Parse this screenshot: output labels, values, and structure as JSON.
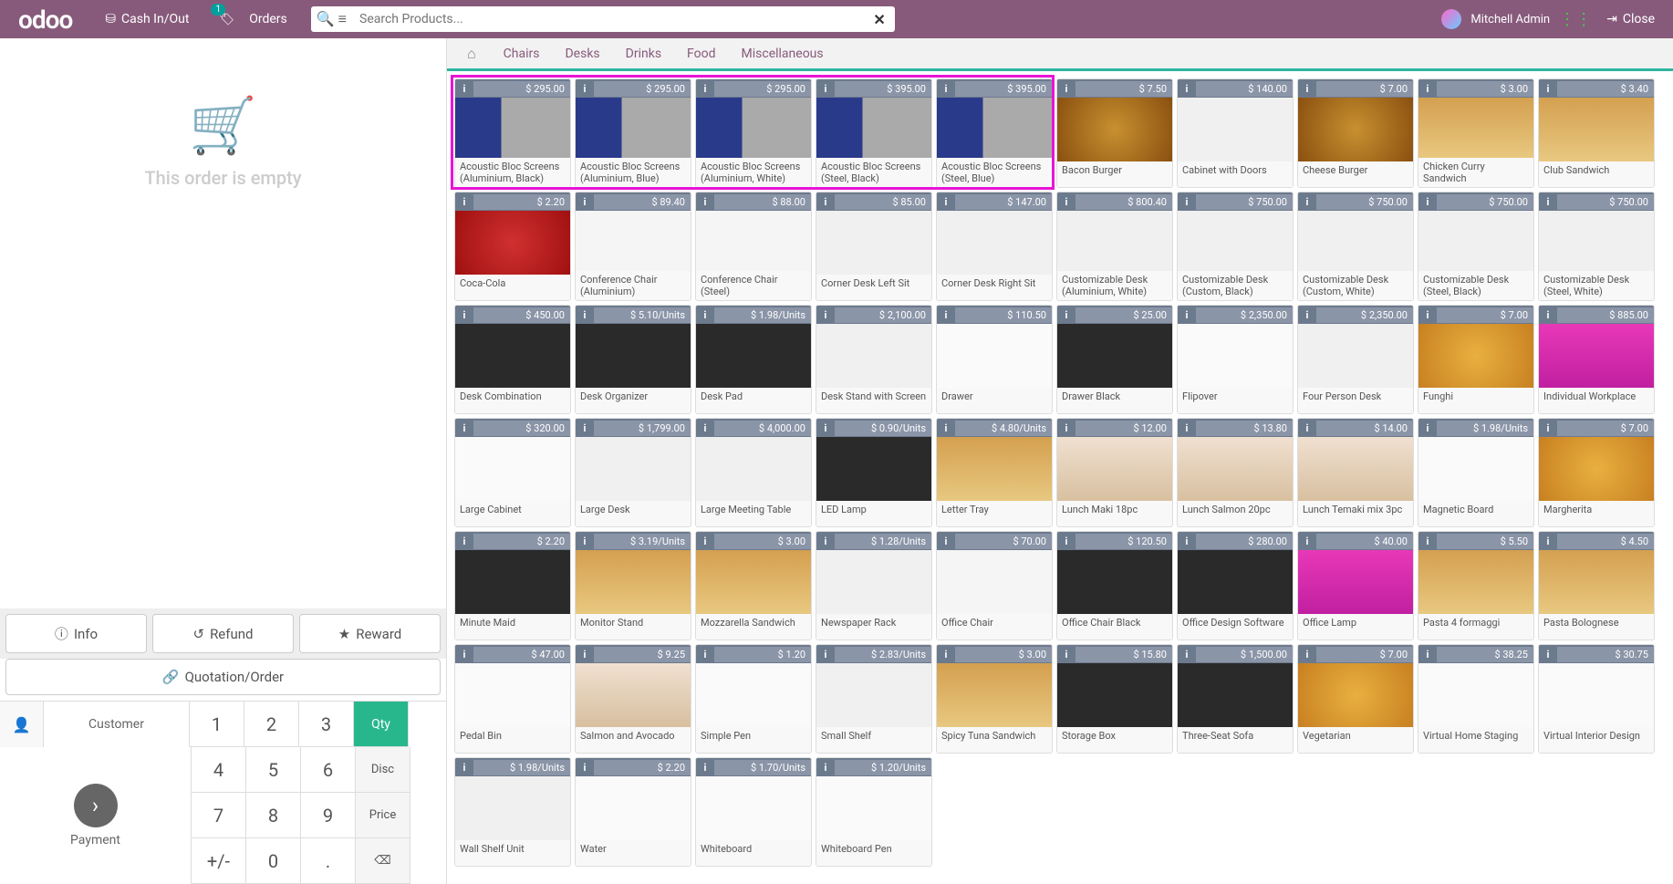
{
  "topbar": {
    "logo": "odoo",
    "cash": "Cash In/Out",
    "orders": "Orders",
    "orders_badge": "1",
    "search_placeholder": "Search Products...",
    "user": "Mitchell Admin",
    "close": "Close"
  },
  "left": {
    "empty": "This order is empty",
    "info": "Info",
    "refund": "Refund",
    "reward": "Reward",
    "quotation": "Quotation/Order",
    "customer": "Customer",
    "payment": "Payment",
    "keys": {
      "k1": "1",
      "k2": "2",
      "k3": "3",
      "k4": "4",
      "k5": "5",
      "k6": "6",
      "k7": "7",
      "k8": "8",
      "k9": "9",
      "k0": "0",
      "kpm": "+/-",
      "kdot": ".",
      "kbs": "⌫"
    },
    "side": {
      "qty": "Qty",
      "disc": "Disc",
      "price": "Price"
    }
  },
  "cats": [
    "Chairs",
    "Desks",
    "Drinks",
    "Food",
    "Miscellaneous"
  ],
  "products": [
    {
      "name": "Acoustic Bloc Screens (Aluminium, Black)",
      "price": "$ 295.00",
      "img": "img-screen"
    },
    {
      "name": "Acoustic Bloc Screens (Aluminium, Blue)",
      "price": "$ 295.00",
      "img": "img-screen"
    },
    {
      "name": "Acoustic Bloc Screens (Aluminium, White)",
      "price": "$ 295.00",
      "img": "img-screen"
    },
    {
      "name": "Acoustic Bloc Screens (Steel, Black)",
      "price": "$ 395.00",
      "img": "img-screen"
    },
    {
      "name": "Acoustic Bloc Screens (Steel, Blue)",
      "price": "$ 395.00",
      "img": "img-screen"
    },
    {
      "name": "Bacon Burger",
      "price": "$ 7.50",
      "img": "img-burger"
    },
    {
      "name": "Cabinet with Doors",
      "price": "$ 140.00",
      "img": "img-cabinet"
    },
    {
      "name": "Cheese Burger",
      "price": "$ 7.00",
      "img": "img-burger"
    },
    {
      "name": "Chicken Curry Sandwich",
      "price": "$ 3.00",
      "img": "img-sandwich"
    },
    {
      "name": "Club Sandwich",
      "price": "$ 3.40",
      "img": "img-sandwich"
    },
    {
      "name": "Coca-Cola",
      "price": "$ 2.20",
      "img": "img-coke"
    },
    {
      "name": "Conference Chair (Aluminium)",
      "price": "$ 89.40",
      "img": "img-chair"
    },
    {
      "name": "Conference Chair (Steel)",
      "price": "$ 88.00",
      "img": "img-chair"
    },
    {
      "name": "Corner Desk Left Sit",
      "price": "$ 85.00",
      "img": "img-desk"
    },
    {
      "name": "Corner Desk Right Sit",
      "price": "$ 147.00",
      "img": "img-desk"
    },
    {
      "name": "Customizable Desk (Aluminium, White)",
      "price": "$ 800.40",
      "img": "img-desk"
    },
    {
      "name": "Customizable Desk (Custom, Black)",
      "price": "$ 750.00",
      "img": "img-desk"
    },
    {
      "name": "Customizable Desk (Custom, White)",
      "price": "$ 750.00",
      "img": "img-desk"
    },
    {
      "name": "Customizable Desk (Steel, Black)",
      "price": "$ 750.00",
      "img": "img-desk"
    },
    {
      "name": "Customizable Desk (Steel, White)",
      "price": "$ 750.00",
      "img": "img-desk"
    },
    {
      "name": "Desk Combination",
      "price": "$ 450.00",
      "img": "img-black"
    },
    {
      "name": "Desk Organizer",
      "price": "$ 5.10/Units",
      "img": "img-black"
    },
    {
      "name": "Desk Pad",
      "price": "$ 1.98/Units",
      "img": "img-black"
    },
    {
      "name": "Desk Stand with Screen",
      "price": "$ 2,100.00",
      "img": "img-desk"
    },
    {
      "name": "Drawer",
      "price": "$ 110.50",
      "img": "img-white"
    },
    {
      "name": "Drawer Black",
      "price": "$ 25.00",
      "img": "img-black"
    },
    {
      "name": "Flipover",
      "price": "$ 2,350.00",
      "img": "img-white"
    },
    {
      "name": "Four Person Desk",
      "price": "$ 2,350.00",
      "img": "img-desk"
    },
    {
      "name": "Funghi",
      "price": "$ 7.00",
      "img": "img-pizza"
    },
    {
      "name": "Individual Workplace",
      "price": "$ 885.00",
      "img": "img-pink"
    },
    {
      "name": "Large Cabinet",
      "price": "$ 320.00",
      "img": "img-white"
    },
    {
      "name": "Large Desk",
      "price": "$ 1,799.00",
      "img": "img-desk"
    },
    {
      "name": "Large Meeting Table",
      "price": "$ 4,000.00",
      "img": "img-desk"
    },
    {
      "name": "LED Lamp",
      "price": "$ 0.90/Units",
      "img": "img-black"
    },
    {
      "name": "Letter Tray",
      "price": "$ 4.80/Units",
      "img": "img-sandwich"
    },
    {
      "name": "Lunch Maki 18pc",
      "price": "$ 12.00",
      "img": "img-sushi"
    },
    {
      "name": "Lunch Salmon 20pc",
      "price": "$ 13.80",
      "img": "img-sushi"
    },
    {
      "name": "Lunch Temaki mix 3pc",
      "price": "$ 14.00",
      "img": "img-sushi"
    },
    {
      "name": "Magnetic Board",
      "price": "$ 1.98/Units",
      "img": "img-white"
    },
    {
      "name": "Margherita",
      "price": "$ 7.00",
      "img": "img-pizza"
    },
    {
      "name": "Minute Maid",
      "price": "$ 2.20",
      "img": "img-black"
    },
    {
      "name": "Monitor Stand",
      "price": "$ 3.19/Units",
      "img": "img-sandwich"
    },
    {
      "name": "Mozzarella Sandwich",
      "price": "$ 3.00",
      "img": "img-sandwich"
    },
    {
      "name": "Newspaper Rack",
      "price": "$ 1.28/Units",
      "img": "img-desk"
    },
    {
      "name": "Office Chair",
      "price": "$ 70.00",
      "img": "img-chair"
    },
    {
      "name": "Office Chair Black",
      "price": "$ 120.50",
      "img": "img-black"
    },
    {
      "name": "Office Design Software",
      "price": "$ 280.00",
      "img": "img-black"
    },
    {
      "name": "Office Lamp",
      "price": "$ 40.00",
      "img": "img-pink"
    },
    {
      "name": "Pasta 4 formaggi",
      "price": "$ 5.50",
      "img": "img-sandwich"
    },
    {
      "name": "Pasta Bolognese",
      "price": "$ 4.50",
      "img": "img-sandwich"
    },
    {
      "name": "Pedal Bin",
      "price": "$ 47.00",
      "img": "img-white"
    },
    {
      "name": "Salmon and Avocado",
      "price": "$ 9.25",
      "img": "img-sushi"
    },
    {
      "name": "Simple Pen",
      "price": "$ 1.20",
      "img": "img-white"
    },
    {
      "name": "Small Shelf",
      "price": "$ 2.83/Units",
      "img": "img-desk"
    },
    {
      "name": "Spicy Tuna Sandwich",
      "price": "$ 3.00",
      "img": "img-sandwich"
    },
    {
      "name": "Storage Box",
      "price": "$ 15.80",
      "img": "img-black"
    },
    {
      "name": "Three-Seat Sofa",
      "price": "$ 1,500.00",
      "img": "img-black"
    },
    {
      "name": "Vegetarian",
      "price": "$ 7.00",
      "img": "img-pizza"
    },
    {
      "name": "Virtual Home Staging",
      "price": "$ 38.25",
      "img": "img-white"
    },
    {
      "name": "Virtual Interior Design",
      "price": "$ 30.75",
      "img": "img-white"
    },
    {
      "name": "Wall Shelf Unit",
      "price": "$ 1.98/Units",
      "img": "img-desk"
    },
    {
      "name": "Water",
      "price": "$ 2.20",
      "img": "img-white"
    },
    {
      "name": "Whiteboard",
      "price": "$ 1.70/Units",
      "img": "img-white"
    },
    {
      "name": "Whiteboard Pen",
      "price": "$ 1.20/Units",
      "img": "img-white"
    }
  ]
}
